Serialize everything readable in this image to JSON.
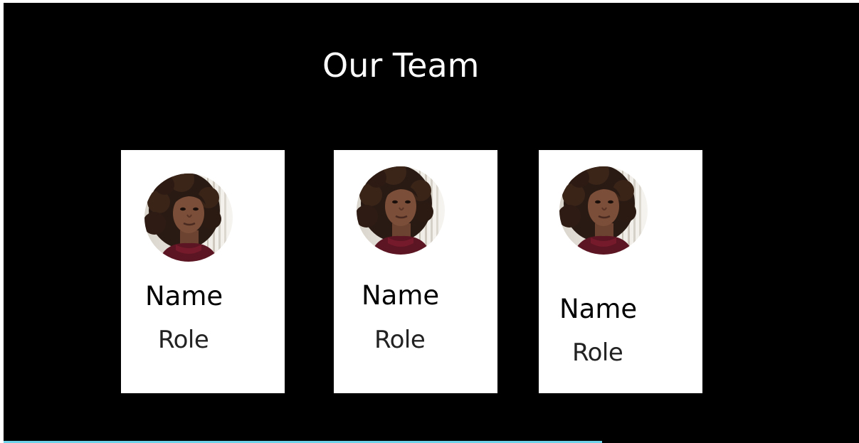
{
  "section": {
    "title": "Our Team"
  },
  "team": [
    {
      "name": "Name",
      "role": "Role",
      "photo_icon": "team-member-photo"
    },
    {
      "name": "Name",
      "role": "Role",
      "photo_icon": "team-member-photo"
    },
    {
      "name": "Name",
      "role": "Role",
      "photo_icon": "team-member-photo"
    }
  ],
  "scroll_progress": 0.7,
  "colors": {
    "background": "#000000",
    "card": "#ffffff",
    "heading": "#ffffff",
    "text": "#000000",
    "progress": "#6fd3ea"
  }
}
